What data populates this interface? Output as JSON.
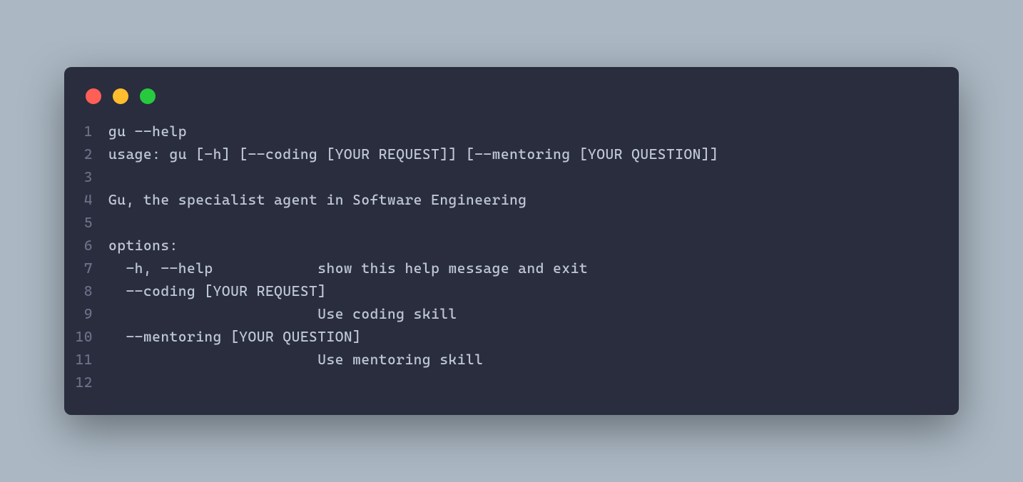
{
  "code": {
    "lines": [
      {
        "num": "1",
        "text": "gu --help"
      },
      {
        "num": "2",
        "text": "usage: gu [-h] [--coding [YOUR REQUEST]] [--mentoring [YOUR QUESTION]]"
      },
      {
        "num": "3",
        "text": ""
      },
      {
        "num": "4",
        "text": "Gu, the specialist agent in Software Engineering"
      },
      {
        "num": "5",
        "text": ""
      },
      {
        "num": "6",
        "text": "options:"
      },
      {
        "num": "7",
        "text": "  -h, --help            show this help message and exit"
      },
      {
        "num": "8",
        "text": "  --coding [YOUR REQUEST]"
      },
      {
        "num": "9",
        "text": "                        Use coding skill"
      },
      {
        "num": "10",
        "text": "  --mentoring [YOUR QUESTION]"
      },
      {
        "num": "11",
        "text": "                        Use mentoring skill"
      },
      {
        "num": "12",
        "text": ""
      }
    ]
  },
  "window": {
    "traffic_lights": {
      "close": "close",
      "minimize": "minimize",
      "maximize": "maximize"
    }
  }
}
